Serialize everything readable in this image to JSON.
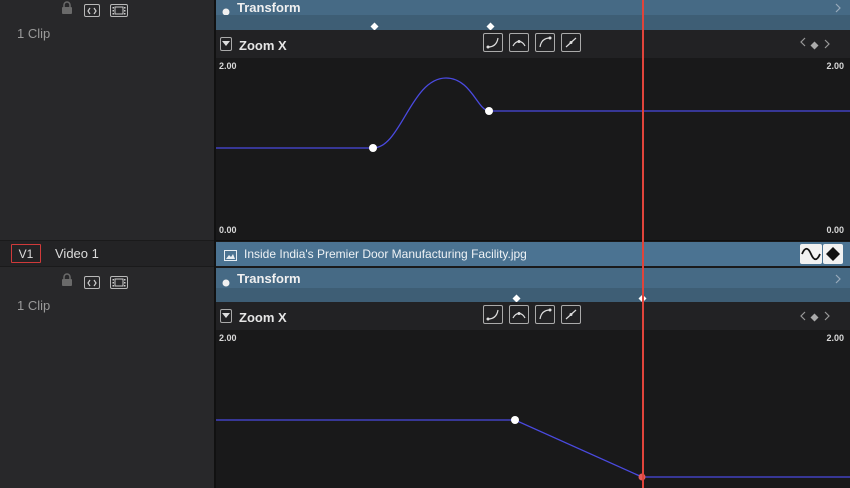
{
  "tracks": [
    {
      "clip_count": "1 Clip",
      "transform_label": "Transform",
      "param_label": "Zoom X",
      "y_max_label": "2.00",
      "y_min_label": "0.00"
    },
    {
      "badge": "V1",
      "name": "Video 1",
      "clip_name": "Inside India's Premier Door Manufacturing Facility.jpg",
      "clip_count": "1 Clip",
      "transform_label": "Transform",
      "param_label": "Zoom X",
      "y_max_label": "2.00"
    }
  ],
  "colors": {
    "playhead": "#e0443b",
    "curve": "#4a4ae0",
    "clip_bar": "#4b7392",
    "track_badge_border": "#d03a3a"
  },
  "icons": [
    "lock-icon",
    "auto-select-icon",
    "film-icon",
    "chevron-down-icon",
    "curve-ease-in-icon",
    "curve-smooth-icon",
    "curve-ease-out-icon",
    "curve-linear-icon",
    "prev-keyframe-icon",
    "keyframe-diamond-icon",
    "next-keyframe-icon",
    "image-icon",
    "curve-toggle-icon",
    "keyframe-toggle-icon"
  ]
}
